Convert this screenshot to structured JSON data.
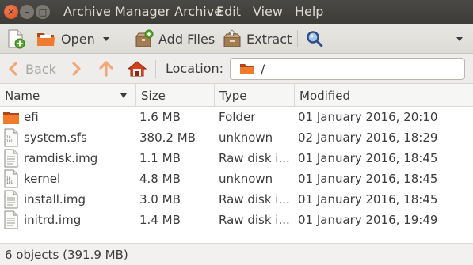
{
  "window": {
    "title": "Archive Manager Archive",
    "ghost_title": "ramdisk.img",
    "menu": [
      "Edit",
      "View",
      "Help"
    ]
  },
  "toolbar": {
    "open_label": "Open",
    "add_files_label": "Add Files",
    "extract_label": "Extract"
  },
  "location": {
    "back_label": "Back",
    "location_label": "Location:",
    "path": "/"
  },
  "columns": {
    "name": "Name",
    "size": "Size",
    "type": "Type",
    "modified": "Modified"
  },
  "files": [
    {
      "name": "efi",
      "size": "1.6 MB",
      "type": "Folder",
      "modified": "01 January 2016, 20:10",
      "icon": "folder-icon"
    },
    {
      "name": "system.sfs",
      "size": "380.2 MB",
      "type": "unknown",
      "modified": "02 January 2016, 18:29",
      "icon": "binary-file-icon"
    },
    {
      "name": "ramdisk.img",
      "size": "1.1 MB",
      "type": "Raw disk i...",
      "modified": "01 January 2016, 18:45",
      "icon": "text-file-icon"
    },
    {
      "name": "kernel",
      "size": "4.8 MB",
      "type": "unknown",
      "modified": "01 January 2016, 18:45",
      "icon": "binary-file-icon"
    },
    {
      "name": "install.img",
      "size": "3.0 MB",
      "type": "Raw disk i...",
      "modified": "01 January 2016, 18:45",
      "icon": "text-file-icon"
    },
    {
      "name": "initrd.img",
      "size": "1.4 MB",
      "type": "Raw disk i...",
      "modified": "01 January 2016, 19:49",
      "icon": "text-file-icon"
    }
  ],
  "status": {
    "text": "6 objects (391.9 MB)"
  }
}
